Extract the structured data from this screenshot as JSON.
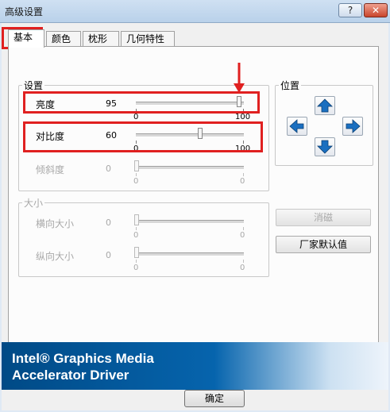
{
  "window": {
    "title": "高级设置",
    "help_label": "?",
    "close_label": "✕"
  },
  "tabs": [
    {
      "label": "基本",
      "active": true
    },
    {
      "label": "颜色",
      "active": false
    },
    {
      "label": "枕形",
      "active": false
    },
    {
      "label": "几何特性",
      "active": false
    }
  ],
  "settings_group": {
    "title": "设置",
    "sliders": [
      {
        "label": "亮度",
        "value": "95",
        "min": "0",
        "max": "100",
        "enabled": true
      },
      {
        "label": "对比度",
        "value": "60",
        "min": "0",
        "max": "100",
        "enabled": true
      },
      {
        "label": "倾斜度",
        "value": "0",
        "min": "0",
        "max": "0",
        "enabled": false
      }
    ]
  },
  "size_group": {
    "title": "大小",
    "sliders": [
      {
        "label": "横向大小",
        "value": "0",
        "min": "0",
        "max": "0",
        "enabled": false
      },
      {
        "label": "纵向大小",
        "value": "0",
        "min": "0",
        "max": "0",
        "enabled": false
      }
    ]
  },
  "position_group": {
    "title": "位置",
    "arrows": [
      "up-arrow-icon",
      "left-arrow-icon",
      "right-arrow-icon",
      "down-arrow-icon"
    ]
  },
  "buttons": {
    "cancel_label": "消磁",
    "defaults_label": "厂家默认值",
    "ok_label": "确定"
  },
  "banner": {
    "line1": "Intel® Graphics Media",
    "line2": "Accelerator Driver"
  },
  "annotation_color": "#e02020",
  "arrow_color": "#1a6fc0"
}
